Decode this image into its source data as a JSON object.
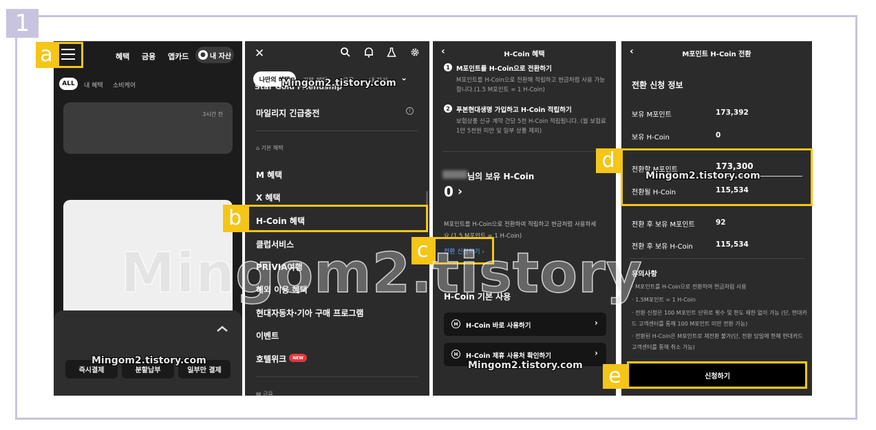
{
  "step_number": "1",
  "tags": {
    "a": "a",
    "b": "b",
    "c": "c",
    "d": "d",
    "e": "e"
  },
  "watermark": "Mingom2.tistory.com",
  "watermark_big": "Mingom2.tistory",
  "screen1": {
    "nav": [
      "혜택",
      "금융",
      "앱카드"
    ],
    "asset": "내 자산",
    "chips": {
      "all": "ALL",
      "mine": "내 혜택",
      "consumer": "소비케어"
    },
    "card_time": "3시간 전",
    "buttons": [
      "즉시결제",
      "분할납부",
      "일부만 결제"
    ]
  },
  "screen2": {
    "close": "✕",
    "tabs": {
      "active": "나만의 혜택",
      "others": [
        "기본 혜택",
        "금융",
        "내 자산"
      ]
    },
    "top_partial": "Star Gold Friendship",
    "mileage": "마일리지 긴급충전",
    "section_basic": "기본 혜택",
    "menu": [
      "M 혜택",
      "X 혜택",
      "H-Coin 혜택",
      "클럽서비스",
      "PRIVIA여행",
      "해외 이용 혜택",
      "현대자동차·기아 구매 프로그램",
      "이벤트",
      "호텔위크"
    ],
    "new_badge": "NEW",
    "section_finance": "금융"
  },
  "screen3": {
    "title": "H-Coin 혜택",
    "steps": [
      {
        "num": "1",
        "title": "M포인트를 H-Coin으로 전환하기",
        "desc": "M포인트를 H-Coin으로 전환해 적립하고 현금처럼 사용 가능합니다.(1.5 M포인트 = 1 H-Coin)"
      },
      {
        "num": "2",
        "title": "푸본현대생명 가입하고 H-Coin 적립하기",
        "desc": "보험상품 신규 계약 건당 5천 H-Coin 적립됩니다. (월 보험료 1만 5천원 미만 및 일부 상품 제외)"
      }
    ],
    "owned_title": "님의 보유 H-Coin",
    "owned_value": "0",
    "convert_desc": "M포인트를 H-Coin으로 전환하여 적립하고 현금처럼 사용하세요 (1.5 M포인트 = 1 H-Coin)",
    "convert_link": "전환 신청하기 ›",
    "basic_use": "H-Coin 기본 사용",
    "rows": [
      "H-Coin 바로 사용하기",
      "H-Coin 제휴 사용처 확인하기"
    ]
  },
  "screen4": {
    "title": "M포인트 H-Coin 전환",
    "section": "전환 신청 정보",
    "info": [
      {
        "label": "보유 M포인트",
        "value": "173,392"
      },
      {
        "label": "보유 H-Coin",
        "value": "0"
      }
    ],
    "convert": [
      {
        "label": "전환할 M포인트",
        "value": "173,300"
      },
      {
        "label": "전환될 H-Coin",
        "value": "115,534"
      }
    ],
    "after": [
      {
        "label": "전환 후 보유 M포인트",
        "value": "92"
      },
      {
        "label": "전환 후 보유 H-Coin",
        "value": "115,534"
      }
    ],
    "notes_title": "유의사항",
    "notes": [
      "M포인트를 H-Coin으로 전환하여 현금처럼 사용",
      "1.5M포인트 = 1 H-Coin",
      "전환 신청은 100 M포인트 단위로 횟수 및 한도 제한 없이 가능 (단, 현대카드 고객센터를 통해 100 M포인트 미만 전환 가능)",
      "전환된 H-Coin은 M포인트로 재전환 불가(단, 전환 당일에 한해 현대카드 고객센터를 통해 취소 가능)"
    ],
    "cta": "신청하기"
  },
  "colors": {
    "highlight": "#f5c518",
    "frame": "#c8c3de",
    "link": "#5ea2ff",
    "new": "#e3363f"
  }
}
